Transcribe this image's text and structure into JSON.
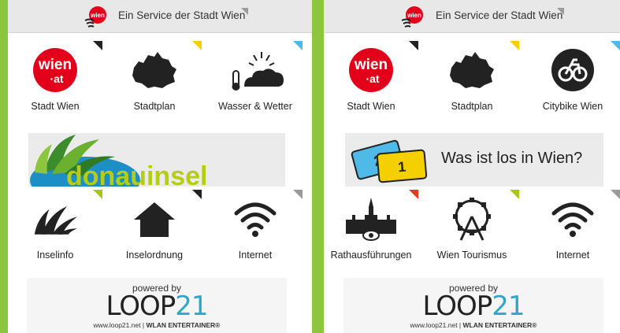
{
  "colors": {
    "frame": "#8cc63f",
    "topbar": "#e8e8e8",
    "marker_black": "#222222",
    "marker_yellow": "#f5d000",
    "marker_blue": "#4fb9e8",
    "marker_gray": "#9a9a9a",
    "marker_lime": "#a7c61b",
    "marker_red": "#e53a1e",
    "wien_red": "#e2001a",
    "loop_blue": "#2fa7c9"
  },
  "left": {
    "header": {
      "logo_text": "wien",
      "title": "Ein Service der Stadt Wien"
    },
    "tiles": [
      {
        "label": "Stadt Wien",
        "icon": "wien-at-logo-icon",
        "logo_top": "wien",
        "logo_bottom": "at",
        "marker": "black"
      },
      {
        "label": "Stadtplan",
        "icon": "vienna-map-icon",
        "marker": "yellow"
      },
      {
        "label": "Wasser & Wetter",
        "icon": "weather-icon",
        "marker": "blue"
      },
      {
        "label": "Inselinfo",
        "icon": "island-leaves-icon",
        "marker": "lime"
      },
      {
        "label": "Inselordnung",
        "icon": "house-icon",
        "marker": "black"
      },
      {
        "label": "Internet",
        "icon": "wifi-icon",
        "marker": "gray"
      }
    ],
    "banner": {
      "text": "donauinsel",
      "icon": "donauinsel-logo"
    },
    "powered": {
      "by": "powered by",
      "brand_a": "LOOP",
      "brand_b": "21",
      "url": "www.loop21.net",
      "tagline": "WLAN ENTERTAINER®"
    }
  },
  "right": {
    "header": {
      "logo_text": "wien",
      "title": "Ein Service der Stadt Wien"
    },
    "tiles": [
      {
        "label": "Stadt Wien",
        "icon": "wien-at-logo-icon",
        "logo_top": "wien",
        "logo_bottom": "at",
        "marker": "black"
      },
      {
        "label": "Stadtplan",
        "icon": "vienna-map-icon",
        "marker": "yellow"
      },
      {
        "label": "Citybike Wien",
        "icon": "citybike-icon",
        "marker": "blue"
      },
      {
        "label": "Rathausführungen",
        "icon": "city-hall-icon",
        "marker": "red"
      },
      {
        "label": "Wien Tourismus",
        "icon": "ferris-wheel-icon",
        "marker": "lime"
      },
      {
        "label": "Internet",
        "icon": "wifi-icon",
        "marker": "gray"
      }
    ],
    "banner": {
      "text": "Was ist los in Wien?",
      "ticket_1": "2",
      "ticket_2": "1",
      "icon": "tickets-icon"
    },
    "powered": {
      "by": "powered by",
      "brand_a": "LOOP",
      "brand_b": "21",
      "url": "www.loop21.net",
      "tagline": "WLAN ENTERTAINER®"
    }
  }
}
